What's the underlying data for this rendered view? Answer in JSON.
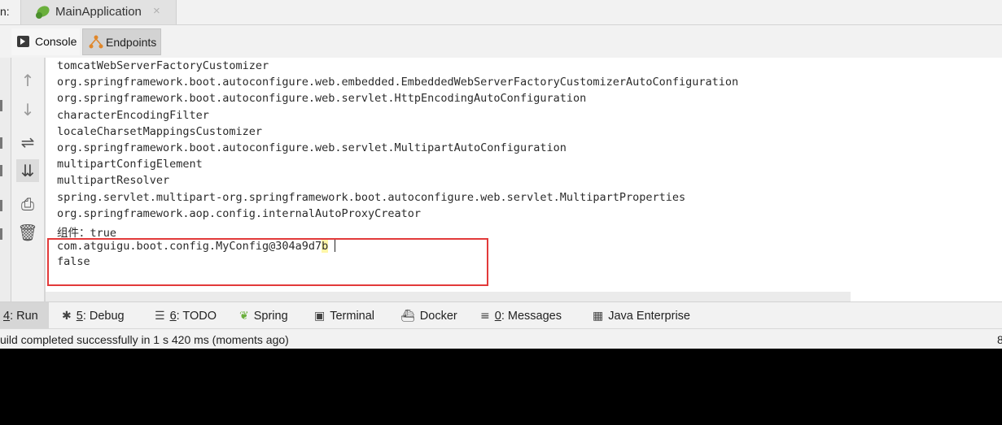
{
  "run_tab": {
    "prefix": "n:",
    "title": "MainApplication",
    "close": "×"
  },
  "tabs": {
    "console": "Console",
    "endpoints": "Endpoints"
  },
  "gutter_icons": [
    "arrow-up-icon",
    "arrow-down-icon",
    "soft-wrap-icon",
    "scroll-to-end-icon",
    "print-icon",
    "trash-icon"
  ],
  "console_lines": [
    "tomcatWebServerFactoryCustomizer",
    "org.springframework.boot.autoconfigure.web.embedded.EmbeddedWebServerFactoryCustomizerAutoConfiguration",
    "org.springframework.boot.autoconfigure.web.servlet.HttpEncodingAutoConfiguration",
    "characterEncodingFilter",
    "localeCharsetMappingsCustomizer",
    "org.springframework.boot.autoconfigure.web.servlet.MultipartAutoConfiguration",
    "multipartConfigElement",
    "multipartResolver",
    "spring.servlet.multipart-org.springframework.boot.autoconfigure.web.servlet.MultipartProperties",
    "org.springframework.aop.config.internalAutoProxyCreator",
    "组件：true"
  ],
  "highlighted": {
    "line1_main": "com.atguigu.boot.config.MyConfig@304a9d7",
    "line1_caret_char": "b",
    "line2": "false"
  },
  "tool_windows": {
    "run": {
      "num": "4",
      "label": ": Run"
    },
    "debug": {
      "num": "5",
      "label": ": Debug"
    },
    "todo": {
      "num": "6",
      "label": ": TODO"
    },
    "spring": {
      "label": "Spring"
    },
    "terminal": {
      "label": "Terminal"
    },
    "docker": {
      "label": "Docker"
    },
    "messages": {
      "num": "0",
      "label": ": Messages"
    },
    "java_enterprise": {
      "label": "Java Enterprise"
    }
  },
  "status": {
    "message": "uild completed successfully in 1 s 420 ms (moments ago)",
    "right": "8"
  },
  "colors": {
    "highlight_border": "#e23a3a",
    "caret_highlight": "#fff6a8",
    "spring_green": "#6aaf3c"
  }
}
